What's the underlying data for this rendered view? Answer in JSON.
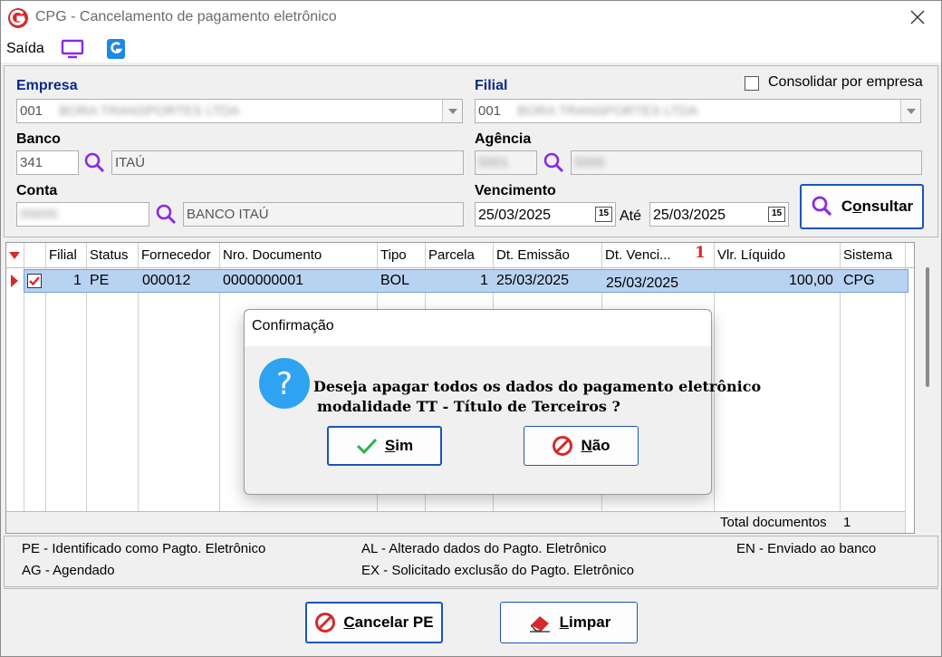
{
  "window": {
    "title": "CPG - Cancelamento de pagamento eletrônico"
  },
  "menu": {
    "exit_label": "Saída"
  },
  "filters": {
    "empresa_label": "Empresa",
    "empresa_code": "001",
    "empresa_name": "BORA TRANSPORTES LTDA",
    "filial_label": "Filial",
    "filial_code": "001",
    "filial_name": "BORA TRANSPORTES LTDA",
    "consolidar_label": "Consolidar por empresa",
    "banco_label": "Banco",
    "banco_code": "341",
    "banco_name": "ITAÚ",
    "agencia_label": "Agência",
    "agencia_code": "0001",
    "agencia_name": "0000",
    "conta_label": "Conta",
    "conta_code": "00000",
    "conta_name": "BANCO ITAÚ",
    "vencimento_label": "Vencimento",
    "date_from": "25/03/2025",
    "ate_label": "Até",
    "date_to": "25/03/2025",
    "cal_label": "15",
    "consultar_label": "Consultar",
    "consultar_hotkey": "o",
    "consultar_prefix": "C",
    "consultar_suffix": "nsultar"
  },
  "grid": {
    "columns": [
      "Filial",
      "Status",
      "Fornecedor",
      "Nro. Documento",
      "Tipo",
      "Parcela",
      "Dt. Emissão",
      "Dt. Venci...",
      "Vlr. Líquido",
      "Sistema"
    ],
    "sort_marker": "1",
    "rows": [
      {
        "filial": "1",
        "status": "PE",
        "fornecedor": "000012",
        "documento": "0000000001",
        "tipo": "BOL",
        "parcela": "1",
        "emissao": "25/03/2025",
        "vencimento": "25/03/2025",
        "valor": "100,00",
        "sistema": "CPG"
      }
    ],
    "total_label": "Total documentos",
    "total_value": "1"
  },
  "legend": {
    "pe": "PE - Identificado como Pagto. Eletrônico",
    "al": "AL - Alterado dados do Pagto. Eletrônico",
    "en": "EN - Enviado ao banco",
    "ag": "AG - Agendado",
    "ex": "EX - Solicitado exclusão do Pagto. Eletrônico"
  },
  "buttons": {
    "cancelar_hotkey": "C",
    "cancelar_rest": "ancelar PE",
    "limpar_hotkey": "L",
    "limpar_rest": "impar"
  },
  "dialog": {
    "title": "Confirmação",
    "line1": "Deseja apagar todos os dados do pagamento eletrônico",
    "line2": "modalidade TT - Título de Terceiros ?",
    "yes_hotkey": "S",
    "yes_rest": "im",
    "no_hotkey": "N",
    "no_rest": "ão"
  },
  "colors": {
    "accent": "#1a55b8",
    "label_blue": "#0b2a8a",
    "selection": "#b8d3f2",
    "icon_red": "#d42a2a",
    "icon_purple": "#8a2be2"
  }
}
